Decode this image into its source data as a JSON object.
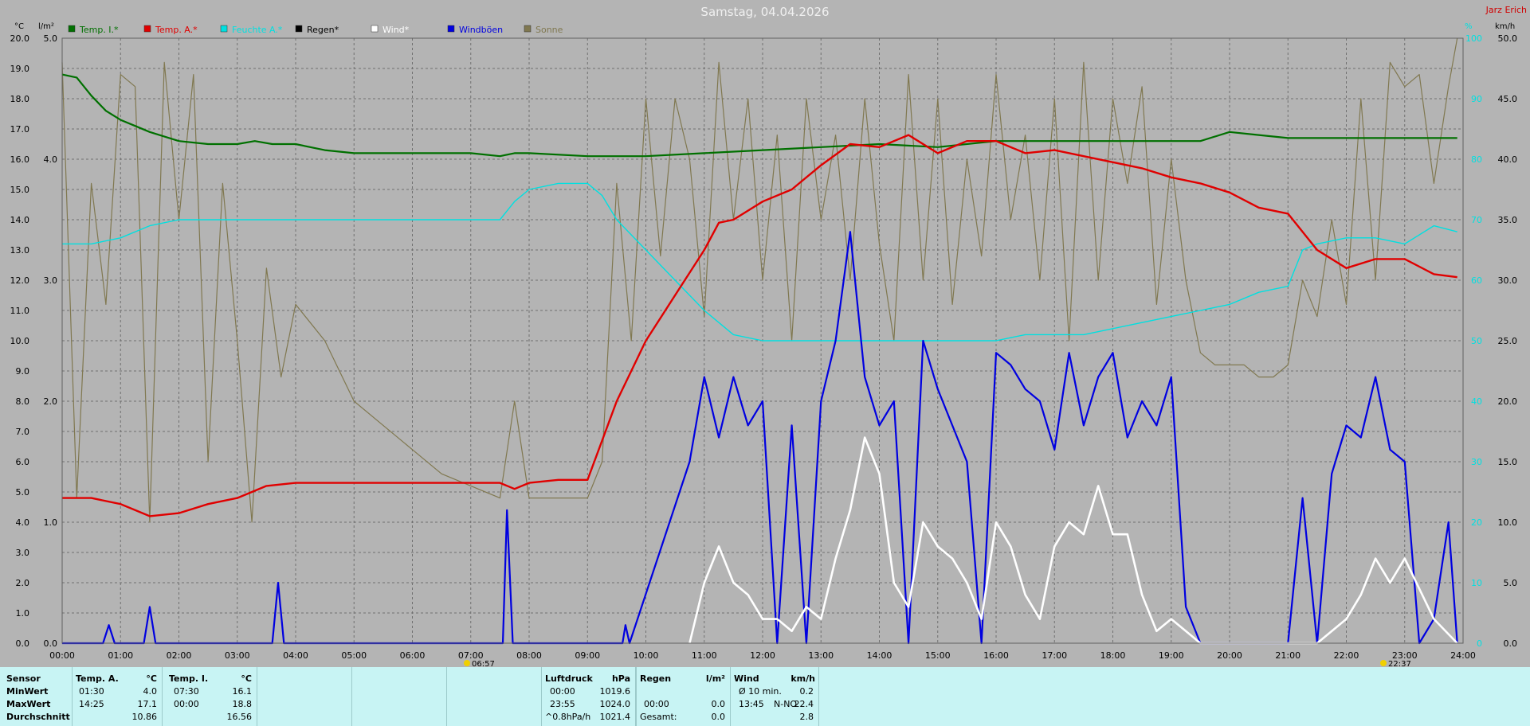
{
  "title": "Samstag, 04.04.2026",
  "author": "Jarz Erich",
  "axes": {
    "left_unit": "°C",
    "left2_unit": "l/m²",
    "right_unit": "%",
    "right2_unit": "km/h"
  },
  "legend": [
    {
      "label": "Temp. I.*",
      "color": "#007000"
    },
    {
      "label": "Temp. A.*",
      "color": "#e00000"
    },
    {
      "label": "Feuchte A.*",
      "color": "#00e0e0"
    },
    {
      "label": "Regen*",
      "color": "#000000"
    },
    {
      "label": "Wind*",
      "color": "#ffffff"
    },
    {
      "label": "Windböen",
      "color": "#0000e0"
    },
    {
      "label": "Sonne",
      "color": "#807850"
    }
  ],
  "sun_markers": {
    "sunrise": "06:57",
    "sunset": "22:37"
  },
  "chart_data": {
    "type": "line",
    "x_ticks": [
      "00:00",
      "01:00",
      "02:00",
      "03:00",
      "04:00",
      "05:00",
      "06:00",
      "07:00",
      "08:00",
      "09:00",
      "10:00",
      "11:00",
      "12:00",
      "13:00",
      "14:00",
      "15:00",
      "16:00",
      "17:00",
      "18:00",
      "19:00",
      "20:00",
      "21:00",
      "22:00",
      "23:00",
      "24:00"
    ],
    "xlim_hours": [
      0,
      24
    ],
    "left_ticks": [
      "0.0",
      "1.0",
      "2.0",
      "3.0",
      "4.0",
      "5.0",
      "6.0",
      "7.0",
      "8.0",
      "9.0",
      "10.0",
      "11.0",
      "12.0",
      "13.0",
      "14.0",
      "15.0",
      "16.0",
      "17.0",
      "18.0",
      "19.0",
      "20.0"
    ],
    "ylim_temp": [
      0,
      20
    ],
    "left2_ticks": [
      "0.0",
      "1.0",
      "2.0",
      "3.0",
      "4.0",
      "5.0"
    ],
    "ylim_rain": [
      0,
      5
    ],
    "right_ticks": [
      "0",
      "10",
      "20",
      "30",
      "40",
      "50",
      "60",
      "70",
      "80",
      "90",
      "100"
    ],
    "ylim_humidity": [
      0,
      100
    ],
    "right2_ticks": [
      "0.0",
      "5.0",
      "10.0",
      "15.0",
      "20.0",
      "25.0",
      "30.0",
      "35.0",
      "40.0",
      "45.0",
      "50.0"
    ],
    "ylim_wind": [
      0,
      50
    ],
    "grid": true,
    "series": [
      {
        "name": "Temp. I.*",
        "axis": "temp",
        "color": "#007000",
        "x": [
          0,
          0.25,
          0.5,
          0.75,
          1.0,
          1.25,
          1.5,
          2.0,
          2.5,
          3.0,
          3.3,
          3.6,
          4.0,
          4.5,
          5.0,
          6.0,
          7.0,
          7.5,
          7.75,
          8.0,
          9.0,
          10.0,
          11.0,
          12.0,
          13.0,
          14.0,
          15.0,
          16.0,
          17.0,
          18.0,
          19.0,
          19.5,
          20.0,
          20.5,
          21.0,
          22.0,
          23.0,
          23.9
        ],
        "y": [
          18.8,
          18.7,
          18.1,
          17.6,
          17.3,
          17.1,
          16.9,
          16.6,
          16.5,
          16.5,
          16.6,
          16.5,
          16.5,
          16.3,
          16.2,
          16.2,
          16.2,
          16.1,
          16.2,
          16.2,
          16.1,
          16.1,
          16.2,
          16.3,
          16.4,
          16.5,
          16.4,
          16.6,
          16.6,
          16.6,
          16.6,
          16.6,
          16.9,
          16.8,
          16.7,
          16.7,
          16.7,
          16.7
        ]
      },
      {
        "name": "Temp. A.*",
        "axis": "temp",
        "color": "#e00000",
        "x": [
          0,
          0.5,
          1.0,
          1.5,
          2.0,
          2.5,
          3.0,
          3.5,
          4.0,
          5.0,
          6.0,
          7.0,
          7.5,
          7.75,
          8.0,
          8.5,
          9.0,
          9.5,
          10.0,
          10.5,
          11.0,
          11.25,
          11.5,
          12.0,
          12.5,
          13.0,
          13.5,
          14.0,
          14.5,
          15.0,
          15.5,
          16.0,
          16.5,
          17.0,
          17.5,
          18.0,
          18.5,
          19.0,
          19.5,
          20.0,
          20.5,
          21.0,
          21.5,
          22.0,
          22.5,
          23.0,
          23.5,
          23.9
        ],
        "y": [
          4.8,
          4.8,
          4.6,
          4.2,
          4.3,
          4.6,
          4.8,
          5.2,
          5.3,
          5.3,
          5.3,
          5.3,
          5.3,
          5.1,
          5.3,
          5.4,
          5.4,
          8.0,
          10.0,
          11.5,
          13.0,
          13.9,
          14.0,
          14.6,
          15.0,
          15.8,
          16.5,
          16.4,
          16.8,
          16.2,
          16.6,
          16.6,
          16.2,
          16.3,
          16.1,
          15.9,
          15.7,
          15.4,
          15.2,
          14.9,
          14.4,
          14.2,
          13.0,
          12.4,
          12.7,
          12.7,
          12.2,
          12.1
        ]
      },
      {
        "name": "Feuchte A.*",
        "axis": "humidity",
        "color": "#00e0e0",
        "x": [
          0,
          0.5,
          1.0,
          1.5,
          2.0,
          2.5,
          3.0,
          4.0,
          5.0,
          6.0,
          7.0,
          7.5,
          7.75,
          8.0,
          8.5,
          9.0,
          9.25,
          9.5,
          10.0,
          10.5,
          11.0,
          11.5,
          12.0,
          12.5,
          13.0,
          13.5,
          14.0,
          14.5,
          15.0,
          15.5,
          16.0,
          16.5,
          17.0,
          17.5,
          18.0,
          18.5,
          19.0,
          19.5,
          20.0,
          20.5,
          21.0,
          21.25,
          21.5,
          22.0,
          22.5,
          23.0,
          23.5,
          23.9
        ],
        "y": [
          66,
          66,
          67,
          69,
          70,
          70,
          70,
          70,
          70,
          70,
          70,
          70,
          73,
          75,
          76,
          76,
          74,
          70,
          65,
          60,
          55,
          51,
          50,
          50,
          50,
          50,
          50,
          50,
          50,
          50,
          50,
          51,
          51,
          51,
          52,
          53,
          54,
          55,
          56,
          58,
          59,
          65,
          66,
          67,
          67,
          66,
          69,
          68
        ]
      },
      {
        "name": "Wind*",
        "axis": "wind",
        "color": "#ffffff",
        "x": [
          10.75,
          11.0,
          11.25,
          11.5,
          11.75,
          12.0,
          12.25,
          12.5,
          12.75,
          13.0,
          13.25,
          13.5,
          13.75,
          14.0,
          14.25,
          14.5,
          14.75,
          15.0,
          15.25,
          15.5,
          15.75,
          16.0,
          16.25,
          16.5,
          16.75,
          17.0,
          17.25,
          17.5,
          17.75,
          18.0,
          18.25,
          18.5,
          18.75,
          19.0,
          19.25,
          19.5,
          20.0,
          20.5,
          21.0,
          21.5,
          22.0,
          22.25,
          22.5,
          22.75,
          23.0,
          23.5,
          23.9
        ],
        "y": [
          0,
          5,
          8,
          5,
          4,
          2,
          2,
          1,
          3,
          2,
          7,
          11,
          17,
          14,
          5,
          3,
          10,
          8,
          7,
          5,
          2,
          10,
          8,
          4,
          2,
          8,
          10,
          9,
          13,
          9,
          9,
          4,
          1,
          2,
          1,
          0,
          0,
          0,
          0,
          0,
          2,
          4,
          7,
          5,
          7,
          2,
          0
        ]
      },
      {
        "name": "Windböen",
        "axis": "wind",
        "color": "#0000e0",
        "x": [
          0,
          0.7,
          0.8,
          0.9,
          1.4,
          1.5,
          1.6,
          3.6,
          3.7,
          3.8,
          7.55,
          7.62,
          7.72,
          9.6,
          9.65,
          9.72,
          10.75,
          11.0,
          11.25,
          11.5,
          11.75,
          12.0,
          12.25,
          12.5,
          12.75,
          13.0,
          13.25,
          13.5,
          13.75,
          14.0,
          14.25,
          14.5,
          14.75,
          15.0,
          15.25,
          15.5,
          15.75,
          16.0,
          16.25,
          16.5,
          16.75,
          17.0,
          17.25,
          17.5,
          17.75,
          18.0,
          18.25,
          18.5,
          18.75,
          19.0,
          19.25,
          19.5,
          20.0,
          20.5,
          21.0,
          21.25,
          21.5,
          21.75,
          22.0,
          22.25,
          22.5,
          22.75,
          23.0,
          23.25,
          23.5,
          23.75,
          23.9
        ],
        "y": [
          0,
          0,
          1.5,
          0,
          0,
          3,
          0,
          0,
          5,
          0,
          0,
          11,
          0,
          0,
          1.5,
          0,
          15,
          22,
          17,
          22,
          18,
          20,
          0,
          18,
          0,
          20,
          25,
          34,
          22,
          18,
          20,
          0,
          25,
          21,
          18,
          15,
          0,
          24,
          23,
          21,
          20,
          16,
          24,
          18,
          22,
          24,
          17,
          20,
          18,
          22,
          3,
          0,
          0,
          0,
          0,
          12,
          0,
          14,
          18,
          17,
          22,
          16,
          15,
          0,
          2,
          10,
          0
        ]
      },
      {
        "name": "Sonne",
        "axis": "rain",
        "color": "#807850",
        "x": [
          0,
          0.25,
          0.5,
          0.75,
          1.0,
          1.25,
          1.5,
          1.75,
          2.0,
          2.25,
          2.5,
          2.75,
          3.0,
          3.25,
          3.5,
          3.75,
          4.0,
          4.5,
          5.0,
          5.5,
          6.0,
          6.5,
          7.0,
          7.5,
          7.75,
          8.0,
          8.5,
          9.0,
          9.25,
          9.5,
          9.75,
          10.0,
          10.25,
          10.5,
          10.75,
          11.0,
          11.25,
          11.5,
          11.75,
          12.0,
          12.25,
          12.5,
          12.75,
          13.0,
          13.25,
          13.5,
          13.75,
          14.0,
          14.25,
          14.5,
          14.75,
          15.0,
          15.25,
          15.5,
          15.75,
          16.0,
          16.25,
          16.5,
          16.75,
          17.0,
          17.25,
          17.5,
          17.75,
          18.0,
          18.25,
          18.5,
          18.75,
          19.0,
          19.25,
          19.5,
          19.75,
          20.0,
          20.25,
          20.5,
          20.75,
          21.0,
          21.25,
          21.5,
          21.75,
          22.0,
          22.25,
          22.5,
          22.75,
          23.0,
          23.25,
          23.5,
          23.75,
          23.9
        ],
        "y": [
          4.8,
          1.2,
          3.8,
          2.8,
          4.7,
          4.6,
          1.0,
          4.8,
          3.5,
          4.7,
          1.5,
          3.8,
          2.5,
          1.0,
          3.1,
          2.2,
          2.8,
          2.5,
          2.0,
          1.8,
          1.6,
          1.4,
          1.3,
          1.2,
          2.0,
          1.2,
          1.2,
          1.2,
          1.5,
          3.8,
          2.5,
          4.5,
          3.2,
          4.5,
          4.0,
          2.7,
          4.8,
          3.5,
          4.5,
          3.0,
          4.2,
          2.5,
          4.5,
          3.5,
          4.2,
          3.0,
          4.5,
          3.3,
          2.5,
          4.7,
          3.0,
          4.5,
          2.8,
          4.0,
          3.2,
          4.7,
          3.5,
          4.2,
          3.0,
          4.5,
          2.5,
          4.8,
          3.0,
          4.5,
          3.8,
          4.6,
          2.8,
          4.0,
          3.0,
          2.4,
          2.3,
          2.3,
          2.3,
          2.2,
          2.2,
          2.3,
          3.0,
          2.7,
          3.5,
          2.8,
          4.5,
          3.0,
          4.8,
          4.6,
          4.7,
          3.8,
          4.6,
          5.0
        ]
      }
    ]
  },
  "stats": {
    "sensor_header": "Sensor",
    "row_labels": [
      "MinWert",
      "MaxWert",
      "Durchschnitt"
    ],
    "temp_a": {
      "header": "Temp. A.",
      "unit": "°C",
      "min_time": "01:30",
      "min": "4.0",
      "max_time": "14:25",
      "max": "17.1",
      "avg": "10.86"
    },
    "temp_i": {
      "header": "Temp. I.",
      "unit": "°C",
      "min_time": "07:30",
      "min": "16.1",
      "max_time": "00:00",
      "max": "18.8",
      "avg": "16.56"
    },
    "pressure": {
      "header": "Luftdruck",
      "unit": "hPa",
      "min_time": "00:00",
      "min": "1019.6",
      "max_time": "23:55",
      "max": "1024.0",
      "trend_label": "^0.8hPa/h",
      "trend_value": "1021.4"
    },
    "rain": {
      "header": "Regen",
      "unit": "l/m²",
      "max_time": "00:00",
      "max": "0.0",
      "total_label": "Gesamt:",
      "total": "0.0"
    },
    "wind": {
      "header": "Wind",
      "unit": "km/h",
      "avg_label": "Ø 10 min.",
      "avg": "0.2",
      "max_time": "13:45",
      "max_dir": "N-NO",
      "max": "22.4",
      "day_avg": "2.8"
    }
  }
}
